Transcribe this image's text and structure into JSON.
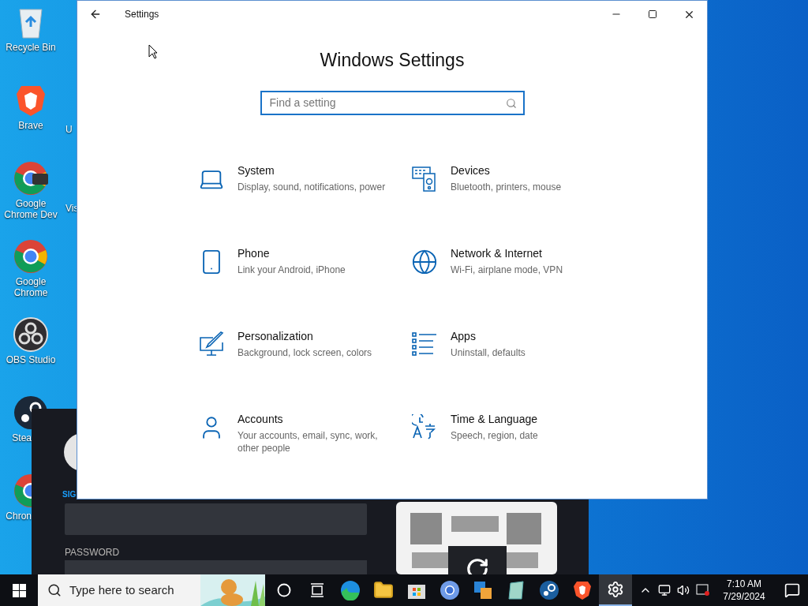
{
  "desktop_icons": [
    {
      "label": "Recycle Bin",
      "kind": "recycle",
      "covered": false
    },
    {
      "label": "Brave",
      "kind": "brave",
      "covered": false
    },
    {
      "label": "Google Chrome Dev",
      "kind": "chrome-dev",
      "covered": false
    },
    {
      "label": "Google Chrome",
      "kind": "chrome",
      "covered": false
    },
    {
      "label": "OBS Studio",
      "kind": "obs",
      "covered": false
    },
    {
      "label": "Stea",
      "kind": "steam",
      "covered": true
    },
    {
      "label": "Chron",
      "kind": "chrome",
      "covered": true
    }
  ],
  "desktop_icons_column_2": [
    {
      "label": "U"
    },
    {
      "label": "Vis"
    }
  ],
  "settings_window": {
    "title": "Settings",
    "heading": "Windows Settings",
    "search": {
      "placeholder": "Find a setting"
    },
    "categories": [
      {
        "title": "System",
        "description": "Display, sound, notifications, power"
      },
      {
        "title": "Devices",
        "description": "Bluetooth, printers, mouse"
      },
      {
        "title": "Phone",
        "description": "Link your Android, iPhone"
      },
      {
        "title": "Network & Internet",
        "description": "Wi-Fi, airplane mode, VPN"
      },
      {
        "title": "Personalization",
        "description": "Background, lock screen, colors"
      },
      {
        "title": "Apps",
        "description": "Uninstall, defaults"
      },
      {
        "title": "Accounts",
        "description": "Your accounts, email, sync, work, other people"
      },
      {
        "title": "Time & Language",
        "description": "Speech, region, date"
      }
    ]
  },
  "steam_window": {
    "sign_in_label": "SIG",
    "password_label": "PASSWORD"
  },
  "taskbar": {
    "search": {
      "placeholder": "Type here to search"
    },
    "apps": [
      {
        "kind": "cortana",
        "selected": false
      },
      {
        "kind": "task-view",
        "selected": false
      },
      {
        "kind": "edge",
        "selected": false
      },
      {
        "kind": "folder",
        "selected": false
      },
      {
        "kind": "store",
        "selected": false
      },
      {
        "kind": "chrome",
        "selected": false
      },
      {
        "kind": "app",
        "selected": false
      },
      {
        "kind": "notepad",
        "selected": false
      },
      {
        "kind": "steam",
        "selected": false
      },
      {
        "kind": "brave",
        "selected": false
      },
      {
        "kind": "settings",
        "selected": true
      }
    ],
    "clock": {
      "time": "7:10 AM",
      "date": "7/29/2024"
    }
  }
}
